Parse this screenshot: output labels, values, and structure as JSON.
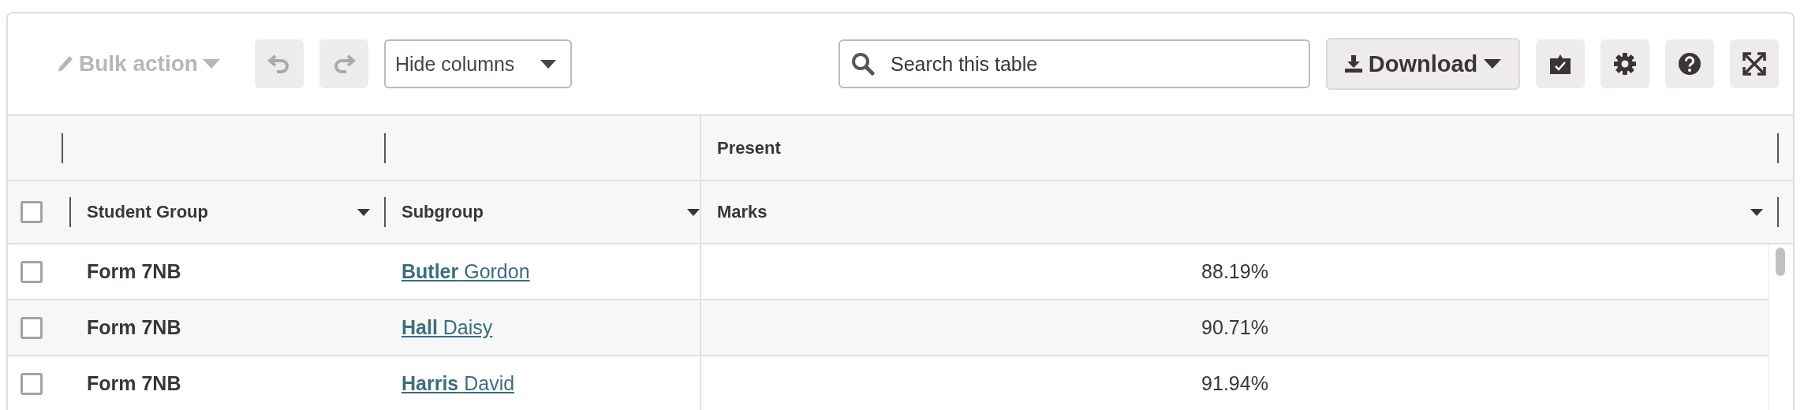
{
  "toolbar": {
    "bulk_action": {
      "label": "Bulk action",
      "disabled": true
    },
    "hide_columns": {
      "label": "Hide columns"
    },
    "search": {
      "placeholder": "Search this table"
    },
    "download": {
      "label": "Download"
    }
  },
  "table": {
    "column_group": "Present",
    "select_all": {
      "checked": false
    },
    "columns": [
      {
        "label": "Student Group"
      },
      {
        "label": "Subgroup"
      },
      {
        "label": "Marks"
      }
    ],
    "rows": [
      {
        "checked": false,
        "student_group": "Form 7NB",
        "subgroup": "**Butler** Gordon",
        "marks": "88.19%"
      },
      {
        "checked": false,
        "student_group": "Form 7NB",
        "subgroup": "**Hall** Daisy",
        "marks": "90.71%"
      },
      {
        "checked": false,
        "student_group": "Form 7NB",
        "subgroup": "**Harris** David",
        "marks": "91.94%"
      }
    ]
  }
}
